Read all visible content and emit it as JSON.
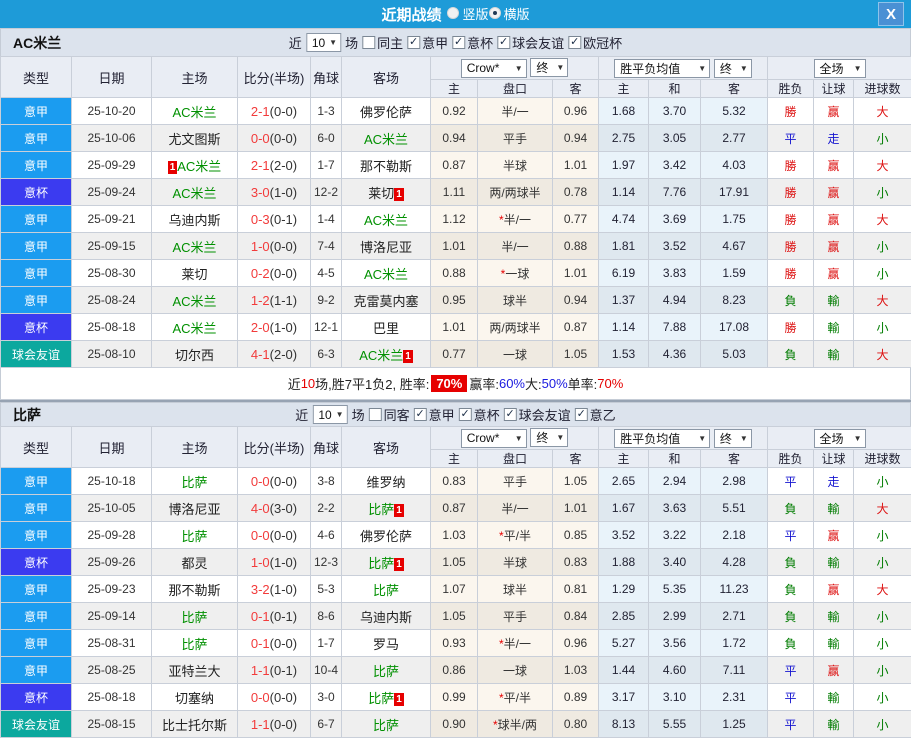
{
  "title_bar": {
    "title": "近期战绩",
    "layout_options": [
      {
        "label": "竖版",
        "selected": false
      },
      {
        "label": "横版",
        "selected": true
      }
    ],
    "close_label": "X"
  },
  "colors": {
    "league": {
      "意甲": "#1b9cf0",
      "意杯": "#3b3bf0",
      "球会友谊": "#0ca89e"
    },
    "result_palette": {
      "red": "#dd1111",
      "blue": "#1515d0",
      "green": "#007c00"
    },
    "result_map": {
      "勝": "red",
      "赢": "red",
      "大": "red",
      "平": "blue",
      "走": "blue",
      "負": "green",
      "輸": "green",
      "小": "green"
    }
  },
  "table_header": {
    "cols": [
      "类型",
      "日期",
      "主场",
      "比分(半场)",
      "角球",
      "客场"
    ],
    "sub": [
      "主",
      "盘口",
      "客",
      "主",
      "和",
      "客",
      "胜负",
      "让球",
      "进球数"
    ],
    "dropdowns": {
      "crow": "Crow*",
      "final": "终",
      "avg": "胜平负均值",
      "scope": "全场"
    }
  },
  "filter_labels": {
    "near": "近",
    "games": "场",
    "count": "10"
  },
  "sections": [
    {
      "team": "AC米兰",
      "filters": [
        {
          "label": "同主",
          "checked": false
        },
        {
          "label": "意甲",
          "checked": true
        },
        {
          "label": "意杯",
          "checked": true
        },
        {
          "label": "球会友谊",
          "checked": true
        },
        {
          "label": "欧冠杯",
          "checked": true
        }
      ],
      "rows": [
        {
          "league": "意甲",
          "date": "25-10-20",
          "home": {
            "name": "AC米兰",
            "self": true
          },
          "score": "2-1",
          "half": "(0-0)",
          "corner": "1-3",
          "away": {
            "name": "佛罗伦萨"
          },
          "crow": [
            "0.92",
            "半/一",
            "0.96"
          ],
          "odds": [
            "1.68",
            "3.70",
            "5.32"
          ],
          "res": [
            "勝",
            "赢",
            "大"
          ]
        },
        {
          "league": "意甲",
          "date": "25-10-06",
          "home": {
            "name": "尤文图斯"
          },
          "score": "0-0",
          "half": "(0-0)",
          "corner": "6-0",
          "away": {
            "name": "AC米兰",
            "self": true
          },
          "crow": [
            "0.94",
            "平手",
            "0.94"
          ],
          "odds": [
            "2.75",
            "3.05",
            "2.77"
          ],
          "res": [
            "平",
            "走",
            "小"
          ]
        },
        {
          "league": "意甲",
          "date": "25-09-29",
          "home": {
            "name": "AC米兰",
            "self": true,
            "card": "1",
            "card_pos": "left"
          },
          "score": "2-1",
          "half": "(2-0)",
          "corner": "1-7",
          "away": {
            "name": "那不勒斯"
          },
          "crow": [
            "0.87",
            "半球",
            "1.01"
          ],
          "odds": [
            "1.97",
            "3.42",
            "4.03"
          ],
          "res": [
            "勝",
            "赢",
            "大"
          ]
        },
        {
          "league": "意杯",
          "date": "25-09-24",
          "home": {
            "name": "AC米兰",
            "self": true
          },
          "score": "3-0",
          "half": "(1-0)",
          "corner": "12-2",
          "away": {
            "name": "莱切",
            "card": "1",
            "card_pos": "right"
          },
          "crow": [
            "1.11",
            "两/两球半",
            "0.78"
          ],
          "odds": [
            "1.14",
            "7.76",
            "17.91"
          ],
          "res": [
            "勝",
            "赢",
            "小"
          ]
        },
        {
          "league": "意甲",
          "date": "25-09-21",
          "home": {
            "name": "乌迪内斯"
          },
          "score": "0-3",
          "half": "(0-1)",
          "corner": "1-4",
          "away": {
            "name": "AC米兰",
            "self": true
          },
          "crow": [
            "1.12",
            "*半/一",
            "0.77"
          ],
          "odds": [
            "4.74",
            "3.69",
            "1.75"
          ],
          "res": [
            "勝",
            "赢",
            "大"
          ]
        },
        {
          "league": "意甲",
          "date": "25-09-15",
          "home": {
            "name": "AC米兰",
            "self": true
          },
          "score": "1-0",
          "half": "(0-0)",
          "corner": "7-4",
          "away": {
            "name": "博洛尼亚"
          },
          "crow": [
            "1.01",
            "半/一",
            "0.88"
          ],
          "odds": [
            "1.81",
            "3.52",
            "4.67"
          ],
          "res": [
            "勝",
            "赢",
            "小"
          ]
        },
        {
          "league": "意甲",
          "date": "25-08-30",
          "home": {
            "name": "莱切"
          },
          "score": "0-2",
          "half": "(0-0)",
          "corner": "4-5",
          "away": {
            "name": "AC米兰",
            "self": true
          },
          "crow": [
            "0.88",
            "*一球",
            "1.01"
          ],
          "odds": [
            "6.19",
            "3.83",
            "1.59"
          ],
          "res": [
            "勝",
            "赢",
            "小"
          ]
        },
        {
          "league": "意甲",
          "date": "25-08-24",
          "home": {
            "name": "AC米兰",
            "self": true
          },
          "score": "1-2",
          "half": "(1-1)",
          "corner": "9-2",
          "away": {
            "name": "克雷莫内塞"
          },
          "crow": [
            "0.95",
            "球半",
            "0.94"
          ],
          "odds": [
            "1.37",
            "4.94",
            "8.23"
          ],
          "res": [
            "負",
            "輸",
            "大"
          ]
        },
        {
          "league": "意杯",
          "date": "25-08-18",
          "home": {
            "name": "AC米兰",
            "self": true
          },
          "score": "2-0",
          "half": "(1-0)",
          "corner": "12-1",
          "away": {
            "name": "巴里"
          },
          "crow": [
            "1.01",
            "两/两球半",
            "0.87"
          ],
          "odds": [
            "1.14",
            "7.88",
            "17.08"
          ],
          "res": [
            "勝",
            "輸",
            "小"
          ]
        },
        {
          "league": "球会友谊",
          "date": "25-08-10",
          "home": {
            "name": "切尔西"
          },
          "score": "4-1",
          "half": "(2-0)",
          "corner": "6-3",
          "away": {
            "name": "AC米兰",
            "self": true,
            "card": "1",
            "card_pos": "right"
          },
          "crow": [
            "0.77",
            "一球",
            "1.05"
          ],
          "odds": [
            "1.53",
            "4.36",
            "5.03"
          ],
          "res": [
            "負",
            "輸",
            "大"
          ]
        }
      ],
      "summary": [
        {
          "text": "近"
        },
        {
          "text": "10",
          "color": "red"
        },
        {
          "text": "场,胜7平1负2, 胜率:"
        },
        {
          "text": "70%",
          "badge": true
        },
        {
          "text": " 赢率:"
        },
        {
          "text": "60%",
          "color": "blue"
        },
        {
          "text": " 大:"
        },
        {
          "text": "50%",
          "color": "blue"
        },
        {
          "text": " 单率:"
        },
        {
          "text": "70%",
          "color": "red"
        }
      ]
    },
    {
      "team": "比萨",
      "filters": [
        {
          "label": "同客",
          "checked": false
        },
        {
          "label": "意甲",
          "checked": true
        },
        {
          "label": "意杯",
          "checked": true
        },
        {
          "label": "球会友谊",
          "checked": true
        },
        {
          "label": "意乙",
          "checked": true
        }
      ],
      "rows": [
        {
          "league": "意甲",
          "date": "25-10-18",
          "home": {
            "name": "比萨",
            "self": true
          },
          "score": "0-0",
          "half": "(0-0)",
          "corner": "3-8",
          "away": {
            "name": "维罗纳"
          },
          "crow": [
            "0.83",
            "平手",
            "1.05"
          ],
          "odds": [
            "2.65",
            "2.94",
            "2.98"
          ],
          "res": [
            "平",
            "走",
            "小"
          ]
        },
        {
          "league": "意甲",
          "date": "25-10-05",
          "home": {
            "name": "博洛尼亚"
          },
          "score": "4-0",
          "half": "(3-0)",
          "corner": "2-2",
          "away": {
            "name": "比萨",
            "self": true,
            "card": "1",
            "card_pos": "right"
          },
          "crow": [
            "0.87",
            "半/一",
            "1.01"
          ],
          "odds": [
            "1.67",
            "3.63",
            "5.51"
          ],
          "res": [
            "負",
            "輸",
            "大"
          ]
        },
        {
          "league": "意甲",
          "date": "25-09-28",
          "home": {
            "name": "比萨",
            "self": true
          },
          "score": "0-0",
          "half": "(0-0)",
          "corner": "4-6",
          "away": {
            "name": "佛罗伦萨"
          },
          "crow": [
            "1.03",
            "*平/半",
            "0.85"
          ],
          "odds": [
            "3.52",
            "3.22",
            "2.18"
          ],
          "res": [
            "平",
            "赢",
            "小"
          ]
        },
        {
          "league": "意杯",
          "date": "25-09-26",
          "home": {
            "name": "都灵"
          },
          "score": "1-0",
          "half": "(1-0)",
          "corner": "12-3",
          "away": {
            "name": "比萨",
            "self": true,
            "card": "1",
            "card_pos": "right"
          },
          "crow": [
            "1.05",
            "半球",
            "0.83"
          ],
          "odds": [
            "1.88",
            "3.40",
            "4.28"
          ],
          "res": [
            "負",
            "輸",
            "小"
          ]
        },
        {
          "league": "意甲",
          "date": "25-09-23",
          "home": {
            "name": "那不勒斯"
          },
          "score": "3-2",
          "half": "(1-0)",
          "corner": "5-3",
          "away": {
            "name": "比萨",
            "self": true
          },
          "crow": [
            "1.07",
            "球半",
            "0.81"
          ],
          "odds": [
            "1.29",
            "5.35",
            "11.23"
          ],
          "res": [
            "負",
            "赢",
            "大"
          ]
        },
        {
          "league": "意甲",
          "date": "25-09-14",
          "home": {
            "name": "比萨",
            "self": true
          },
          "score": "0-1",
          "half": "(0-1)",
          "corner": "8-6",
          "away": {
            "name": "乌迪内斯"
          },
          "crow": [
            "1.05",
            "平手",
            "0.84"
          ],
          "odds": [
            "2.85",
            "2.99",
            "2.71"
          ],
          "res": [
            "負",
            "輸",
            "小"
          ]
        },
        {
          "league": "意甲",
          "date": "25-08-31",
          "home": {
            "name": "比萨",
            "self": true
          },
          "score": "0-1",
          "half": "(0-0)",
          "corner": "1-7",
          "away": {
            "name": "罗马"
          },
          "crow": [
            "0.93",
            "*半/一",
            "0.96"
          ],
          "odds": [
            "5.27",
            "3.56",
            "1.72"
          ],
          "res": [
            "負",
            "輸",
            "小"
          ]
        },
        {
          "league": "意甲",
          "date": "25-08-25",
          "home": {
            "name": "亚特兰大"
          },
          "score": "1-1",
          "half": "(0-1)",
          "corner": "10-4",
          "away": {
            "name": "比萨",
            "self": true
          },
          "crow": [
            "0.86",
            "一球",
            "1.03"
          ],
          "odds": [
            "1.44",
            "4.60",
            "7.11"
          ],
          "res": [
            "平",
            "赢",
            "小"
          ]
        },
        {
          "league": "意杯",
          "date": "25-08-18",
          "home": {
            "name": "切塞纳"
          },
          "score": "0-0",
          "half": "(0-0)",
          "corner": "3-0",
          "away": {
            "name": "比萨",
            "self": true,
            "card": "1",
            "card_pos": "right"
          },
          "crow": [
            "0.99",
            "*平/半",
            "0.89"
          ],
          "odds": [
            "3.17",
            "3.10",
            "2.31"
          ],
          "res": [
            "平",
            "輸",
            "小"
          ]
        },
        {
          "league": "球会友谊",
          "date": "25-08-15",
          "home": {
            "name": "比士托尔斯"
          },
          "score": "1-1",
          "half": "(0-0)",
          "corner": "6-7",
          "away": {
            "name": "比萨",
            "self": true
          },
          "crow": [
            "0.90",
            "*球半/两",
            "0.80"
          ],
          "odds": [
            "8.13",
            "5.55",
            "1.25"
          ],
          "res": [
            "平",
            "輸",
            "小"
          ]
        }
      ]
    }
  ]
}
